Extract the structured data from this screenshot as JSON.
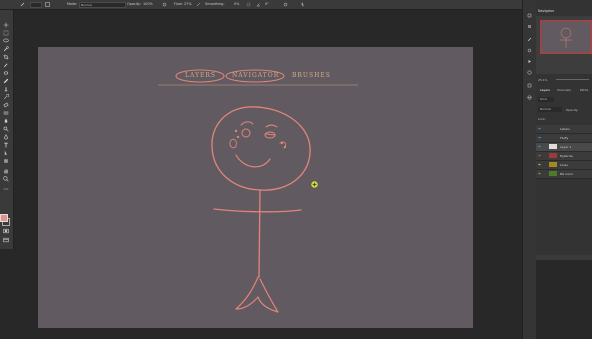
{
  "options_bar": {
    "mode_label": "Mode:",
    "mode_value": "Normal",
    "opacity_label": "Opacity:",
    "opacity_value": "100%",
    "flow_label": "Flow:",
    "flow_value": "27%",
    "smoothing_label": "Smoothing:",
    "smoothing_value": "0%",
    "angle_value": "0°"
  },
  "canvas": {
    "color": "#625a61",
    "header_items": [
      "LAYERS",
      "NAVIGATOR",
      "BRUSHES"
    ],
    "ink_color": "#e0857b"
  },
  "right_panel": {
    "navigator_tab": "Navigator",
    "zoom_value": "25.1%",
    "tabs": [
      "Layers",
      "Channels",
      "Paths"
    ],
    "kind_label": "Kind",
    "blend_mode": "Normal",
    "opacity_label": "Opacity:",
    "lock_label": "Lock:",
    "layers": [
      {
        "name": "Labels",
        "color": ""
      },
      {
        "name": "Fluffy",
        "color": ""
      },
      {
        "name": "Layer 1",
        "color": ""
      },
      {
        "name": "Eyebrow",
        "color": "#9b3a3a"
      },
      {
        "name": "Lines",
        "color": "#a38a1c"
      },
      {
        "name": "BG Color",
        "color": "#4f7a2a"
      }
    ]
  },
  "colors": {
    "foreground": "#e8908a",
    "background": "#ffffff",
    "accent_blue": "#4b85c7"
  },
  "icons": [
    "brush-icon",
    "move-icon",
    "marquee-icon",
    "lasso-icon",
    "quick-select-icon",
    "crop-icon",
    "eyedropper-icon",
    "healing-icon",
    "brush-tool-icon",
    "stamp-icon",
    "history-brush-icon",
    "eraser-icon",
    "gradient-icon",
    "blur-icon",
    "dodge-icon",
    "pen-icon",
    "type-icon",
    "path-select-icon",
    "shape-icon",
    "hand-icon",
    "zoom-icon",
    "edit-toolbar-icon"
  ]
}
